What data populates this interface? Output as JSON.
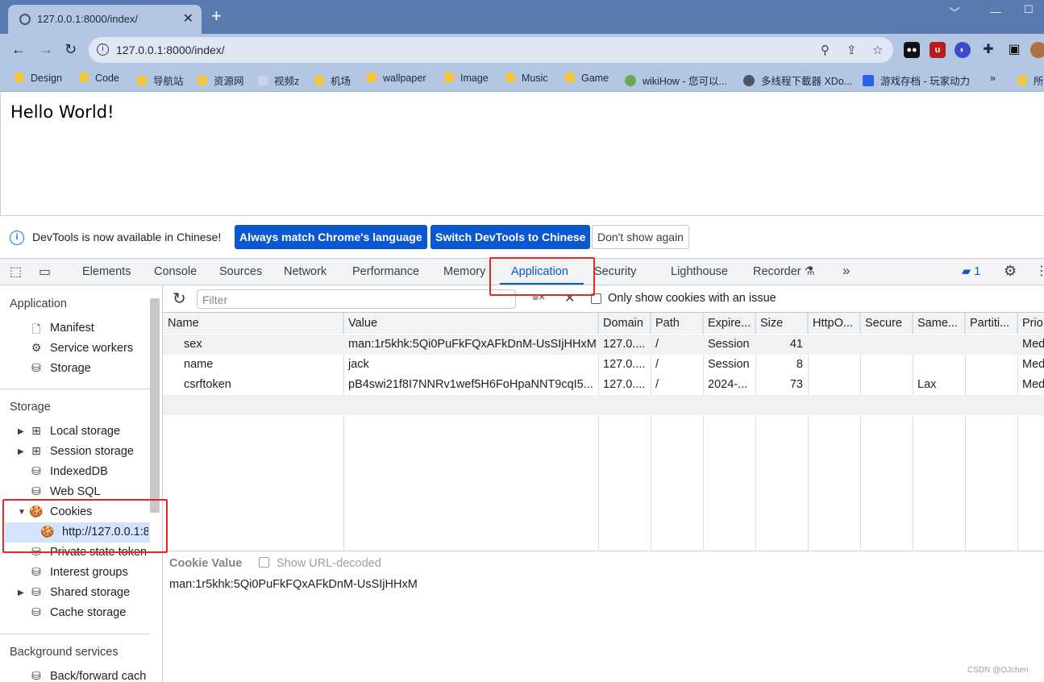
{
  "browser": {
    "tab_title": "127.0.0.1:8000/index/",
    "url": "127.0.0.1:8000/index/",
    "bookmarks": [
      "Design",
      "Code",
      "导航站",
      "资源网",
      "视频z",
      "机场",
      "wallpaper",
      "Image",
      "Music",
      "Game",
      "wikiHow - 您可以...",
      "多线程下載器 XDo...",
      "游戏存档 - 玩家动力",
      "»",
      "所"
    ]
  },
  "page": {
    "heading": "Hello World!"
  },
  "devtools": {
    "infobar": {
      "message": "DevTools is now available in Chinese!",
      "btn_match": "Always match Chrome's language",
      "btn_switch": "Switch DevTools to Chinese",
      "btn_dismiss": "Don't show again"
    },
    "tabs": [
      "Elements",
      "Console",
      "Sources",
      "Network",
      "Performance",
      "Memory",
      "Application",
      "Security",
      "Lighthouse",
      "Recorder",
      "»"
    ],
    "issues_count": "1",
    "sidebar": {
      "application_title": "Application",
      "application_items": [
        "Manifest",
        "Service workers",
        "Storage"
      ],
      "storage_title": "Storage",
      "storage_items": [
        "Local storage",
        "Session storage",
        "IndexedDB",
        "Web SQL",
        "Cookies",
        "http://127.0.0.1:8",
        "Private state token",
        "Interest groups",
        "Shared storage",
        "Cache storage"
      ],
      "bg_title": "Background services",
      "bg_items": [
        "Back/forward cach"
      ]
    },
    "toolbar": {
      "filter_placeholder": "Filter",
      "only_issues": "Only show cookies with an issue"
    },
    "table": {
      "headers": [
        "Name",
        "Value",
        "Domain",
        "Path",
        "Expire...",
        "Size",
        "HttpO...",
        "Secure",
        "Same...",
        "Partiti...",
        "Prio"
      ],
      "rows": [
        [
          "sex",
          "man:1r5khk:5Qi0PuFkFQxAFkDnM-UsSIjHHxM",
          "127.0....",
          "/",
          "Session",
          "41",
          "",
          "",
          "",
          "",
          "Med"
        ],
        [
          "name",
          "jack",
          "127.0....",
          "/",
          "Session",
          "8",
          "",
          "",
          "",
          "",
          "Med"
        ],
        [
          "csrftoken",
          "pB4swi21f8I7NNRv1wef5H6FoHpaNNT9cqI5...",
          "127.0....",
          "/",
          "2024-...",
          "73",
          "",
          "",
          "Lax",
          "",
          "Med"
        ]
      ]
    },
    "cookie_value": {
      "label": "Cookie Value",
      "decode_label": "Show URL-decoded",
      "value": "man:1r5khk:5Qi0PuFkFQxAFkDnM-UsSIjHHxM"
    }
  },
  "watermark": "CSDN @OJchen"
}
